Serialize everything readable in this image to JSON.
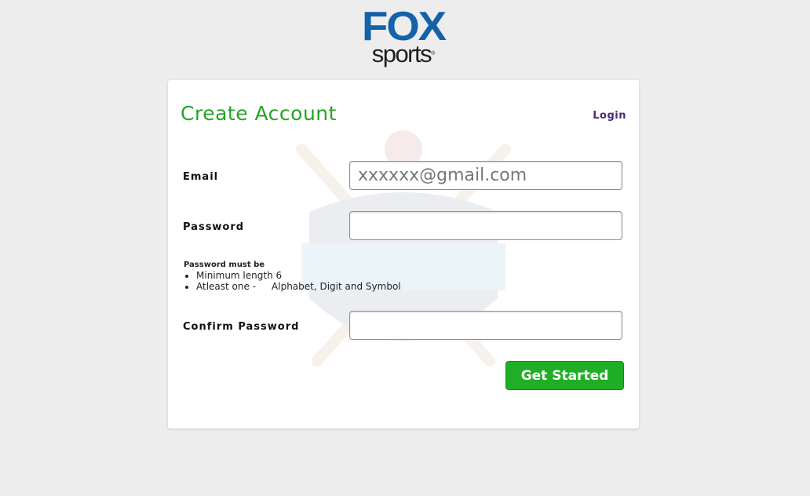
{
  "brand": {
    "logo_top": "FOX",
    "logo_bottom": "sports"
  },
  "form": {
    "title": "Create Account",
    "login_link": "Login",
    "email_label": "Email",
    "email_placeholder": "xxxxxx@gmail.com",
    "password_label": "Password",
    "password_value": "",
    "confirm_label": "Confirm Password",
    "confirm_value": "",
    "rules_title": "Password must be",
    "rule_1": "Minimum length 6",
    "rule_2_prefix": "Atleast one -",
    "rule_2_text": "Alphabet, Digit and Symbol",
    "submit_label": "Get Started"
  },
  "colors": {
    "title": "#26a326",
    "button": "#1fae25",
    "link": "#4c2a73",
    "brand_blue": "#1462a8"
  },
  "watermark": {
    "icon": "cricket-logo-watermark"
  }
}
